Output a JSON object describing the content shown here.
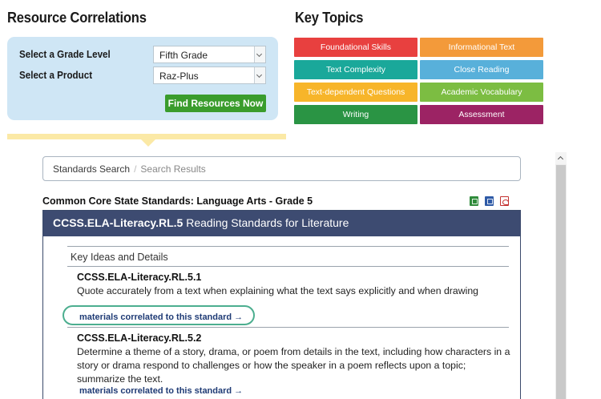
{
  "resource_correlations": {
    "title": "Resource Correlations",
    "grade_label": "Select a Grade Level",
    "grade_value": "Fifth Grade",
    "product_label": "Select a Product",
    "product_value": "Raz-Plus",
    "find_button": "Find Resources Now"
  },
  "key_topics": {
    "title": "Key Topics",
    "buttons": [
      {
        "label": "Foundational Skills",
        "color": "#e8403f"
      },
      {
        "label": "Informational Text",
        "color": "#f39a3a"
      },
      {
        "label": "Text Complexity",
        "color": "#1aa89a"
      },
      {
        "label": "Close Reading",
        "color": "#58b0da"
      },
      {
        "label": "Text-dependent Questions",
        "color": "#f7b52a"
      },
      {
        "label": "Academic Vocabulary",
        "color": "#7cbd42"
      },
      {
        "label": "Writing",
        "color": "#2a9444"
      },
      {
        "label": "Assessment",
        "color": "#9c2364"
      }
    ]
  },
  "breadcrumb": {
    "home": "Standards Search",
    "separator": "/",
    "current": "Search Results"
  },
  "standards": {
    "heading": "Common Core State Standards:  Language Arts - Grade 5",
    "card_code": "CCSS.ELA-Literacy.RL.5",
    "card_title": " Reading Standards for Literature",
    "section": "Key Ideas and Details",
    "items": [
      {
        "code": "CCSS.ELA-Literacy.RL.5.1",
        "text": "Quote accurately from a text when explaining what the text says explicitly and when drawing inferences from the text.",
        "link": "materials correlated to this standard →"
      },
      {
        "code": "CCSS.ELA-Literacy.RL.5.2",
        "text": "Determine a theme of a story, drama, or poem from details in the text, including how characters in a story or drama respond to challenges or how the speaker in a poem reflects upon a topic; summarize the text.",
        "link": "materials correlated to this standard →"
      }
    ]
  },
  "colors": {
    "panel_bg": "#cfe6f5",
    "card_header": "#3d4b71",
    "find_button": "#3a9c2c",
    "highlight_ring": "#4cae8f"
  }
}
